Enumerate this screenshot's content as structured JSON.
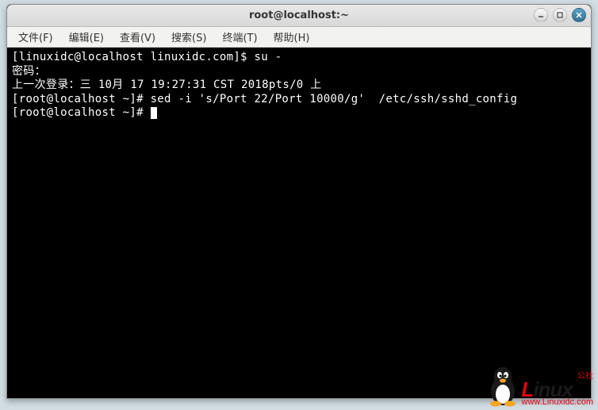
{
  "window": {
    "title": "root@localhost:~"
  },
  "menu": {
    "file": "文件(F)",
    "edit": "编辑(E)",
    "view": "查看(V)",
    "search": "搜索(S)",
    "terminal": "终端(T)",
    "help": "帮助(H)"
  },
  "terminal": {
    "lines": [
      "[linuxidc@localhost linuxidc.com]$ su -",
      "密码：",
      "上一次登录：三 10月 17 19:27:31 CST 2018pts/0 上",
      "[root@localhost ~]# sed -i 's/Port 22/Port 10000/g'  /etc/ssh/sshd_config",
      "[root@localhost ~]# "
    ]
  },
  "watermark": {
    "cntag": "公社",
    "logo_part1": "L",
    "logo_part2": "inux",
    "url": "www.Linuxidc.com"
  }
}
